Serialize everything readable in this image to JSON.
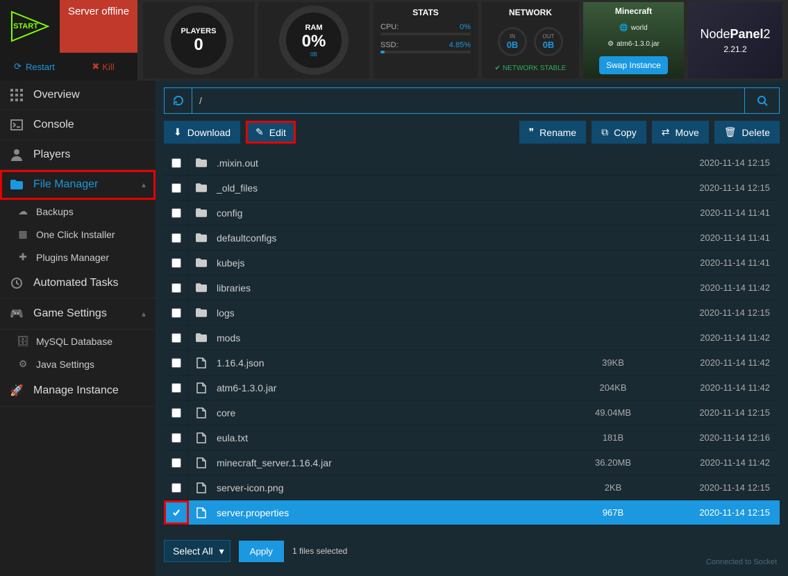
{
  "server": {
    "start_label": "START",
    "status": "Server offline",
    "restart": "Restart",
    "kill": "Kill"
  },
  "gauges": {
    "players": {
      "title": "PLAYERS",
      "value": "0"
    },
    "ram": {
      "title": "RAM",
      "value": "0%",
      "sub": "0B"
    }
  },
  "stats": {
    "title": "STATS",
    "cpu_label": "CPU:",
    "cpu_value": "0%",
    "cpu_pct": 0,
    "ssd_label": "SSD:",
    "ssd_value": "4.85%",
    "ssd_pct": 4.85
  },
  "network": {
    "title": "NETWORK",
    "in_label": "IN",
    "in_value": "0B",
    "out_label": "OUT",
    "out_value": "0B",
    "stable": "NETWORK STABLE"
  },
  "minecraft": {
    "title": "Minecraft",
    "world": "world",
    "jar": "atm6-1.3.0.jar",
    "swap": "Swap Instance"
  },
  "nodepanel": {
    "name_a": "Node",
    "name_b": "Panel",
    "suffix": "2",
    "version": "2.21.2"
  },
  "sidebar": {
    "items": [
      {
        "label": "Overview"
      },
      {
        "label": "Console"
      },
      {
        "label": "Players"
      },
      {
        "label": "File Manager"
      },
      {
        "label": "Automated Tasks"
      },
      {
        "label": "Game Settings"
      },
      {
        "label": "Manage Instance"
      }
    ],
    "file_subs": [
      {
        "label": "Backups"
      },
      {
        "label": "One Click Installer"
      },
      {
        "label": "Plugins Manager"
      }
    ],
    "game_subs": [
      {
        "label": "MySQL Database"
      },
      {
        "label": "Java Settings"
      }
    ]
  },
  "path": {
    "value": "/"
  },
  "toolbar": {
    "download": "Download",
    "edit": "Edit",
    "rename": "Rename",
    "copy": "Copy",
    "move": "Move",
    "delete": "Delete"
  },
  "files": [
    {
      "type": "folder",
      "name": ".mixin.out",
      "size": "",
      "date": "2020-11-14 12:15",
      "selected": false
    },
    {
      "type": "folder",
      "name": "_old_files",
      "size": "",
      "date": "2020-11-14 12:15",
      "selected": false
    },
    {
      "type": "folder",
      "name": "config",
      "size": "",
      "date": "2020-11-14 11:41",
      "selected": false
    },
    {
      "type": "folder",
      "name": "defaultconfigs",
      "size": "",
      "date": "2020-11-14 11:41",
      "selected": false
    },
    {
      "type": "folder",
      "name": "kubejs",
      "size": "",
      "date": "2020-11-14 11:41",
      "selected": false
    },
    {
      "type": "folder",
      "name": "libraries",
      "size": "",
      "date": "2020-11-14 11:42",
      "selected": false
    },
    {
      "type": "folder",
      "name": "logs",
      "size": "",
      "date": "2020-11-14 12:15",
      "selected": false
    },
    {
      "type": "folder",
      "name": "mods",
      "size": "",
      "date": "2020-11-14 11:42",
      "selected": false
    },
    {
      "type": "file",
      "name": "1.16.4.json",
      "size": "39KB",
      "date": "2020-11-14 11:42",
      "selected": false
    },
    {
      "type": "file",
      "name": "atm6-1.3.0.jar",
      "size": "204KB",
      "date": "2020-11-14 11:42",
      "selected": false
    },
    {
      "type": "file",
      "name": "core",
      "size": "49.04MB",
      "date": "2020-11-14 12:15",
      "selected": false
    },
    {
      "type": "file",
      "name": "eula.txt",
      "size": "181B",
      "date": "2020-11-14 12:16",
      "selected": false
    },
    {
      "type": "file",
      "name": "minecraft_server.1.16.4.jar",
      "size": "36.20MB",
      "date": "2020-11-14 11:42",
      "selected": false
    },
    {
      "type": "file",
      "name": "server-icon.png",
      "size": "2KB",
      "date": "2020-11-14 12:15",
      "selected": false
    },
    {
      "type": "file",
      "name": "server.properties",
      "size": "967B",
      "date": "2020-11-14 12:15",
      "selected": true
    }
  ],
  "bottom": {
    "select_all": "Select All",
    "apply": "Apply",
    "selected_info": "1 files selected",
    "socket": "Connected to Socket"
  }
}
